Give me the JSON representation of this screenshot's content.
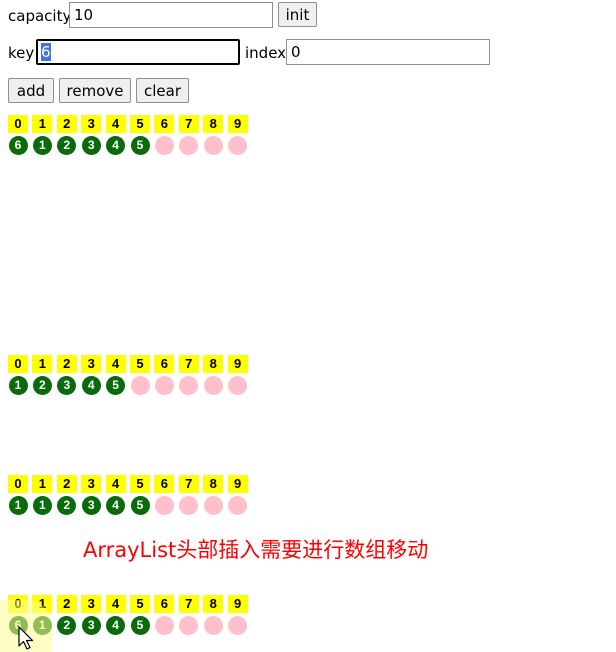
{
  "controls": {
    "capacity_label": "capacity",
    "capacity_value": "10",
    "init_label": "init",
    "key_label": "key",
    "key_value": "6",
    "index_label": "index",
    "index_value": "0",
    "add_label": "add",
    "remove_label": "remove",
    "clear_label": "clear"
  },
  "indices": [
    "0",
    "1",
    "2",
    "3",
    "4",
    "5",
    "6",
    "7",
    "8",
    "9"
  ],
  "snapshots": [
    {
      "cells": [
        "6",
        "1",
        "2",
        "3",
        "4",
        "5",
        "",
        "",
        "",
        ""
      ]
    },
    {
      "cells": [
        "1",
        "2",
        "3",
        "4",
        "5",
        "",
        "",
        "",
        "",
        ""
      ]
    },
    {
      "cells": [
        "1",
        "1",
        "2",
        "3",
        "4",
        "5",
        "",
        "",
        "",
        ""
      ]
    },
    {
      "cells": [
        "6",
        "1",
        "2",
        "3",
        "4",
        "5",
        "",
        "",
        "",
        ""
      ]
    }
  ],
  "caption": "ArrayList头部插入需要进行数组移动",
  "colors": {
    "index_bg": "#ffff00",
    "filled_cell": "#0a6b0a",
    "empty_cell": "#ffc0cb",
    "caption": "#ff0000"
  }
}
